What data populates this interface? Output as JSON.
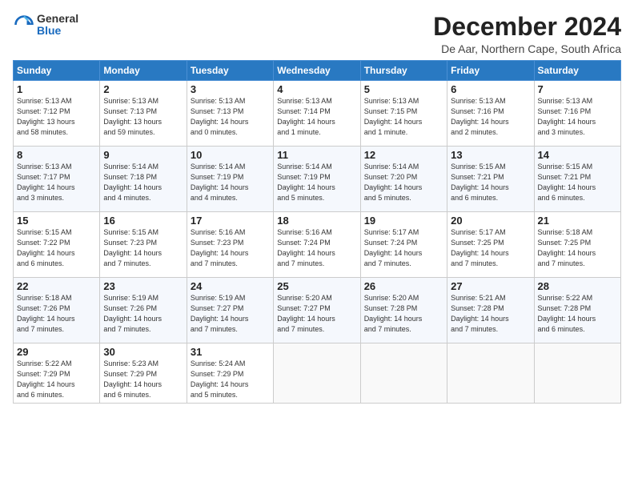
{
  "header": {
    "logo_general": "General",
    "logo_blue": "Blue",
    "month_title": "December 2024",
    "subtitle": "De Aar, Northern Cape, South Africa"
  },
  "weekdays": [
    "Sunday",
    "Monday",
    "Tuesday",
    "Wednesday",
    "Thursday",
    "Friday",
    "Saturday"
  ],
  "weeks": [
    [
      {
        "day": "1",
        "info": "Sunrise: 5:13 AM\nSunset: 7:12 PM\nDaylight: 13 hours\nand 58 minutes."
      },
      {
        "day": "2",
        "info": "Sunrise: 5:13 AM\nSunset: 7:13 PM\nDaylight: 13 hours\nand 59 minutes."
      },
      {
        "day": "3",
        "info": "Sunrise: 5:13 AM\nSunset: 7:13 PM\nDaylight: 14 hours\nand 0 minutes."
      },
      {
        "day": "4",
        "info": "Sunrise: 5:13 AM\nSunset: 7:14 PM\nDaylight: 14 hours\nand 1 minute."
      },
      {
        "day": "5",
        "info": "Sunrise: 5:13 AM\nSunset: 7:15 PM\nDaylight: 14 hours\nand 1 minute."
      },
      {
        "day": "6",
        "info": "Sunrise: 5:13 AM\nSunset: 7:16 PM\nDaylight: 14 hours\nand 2 minutes."
      },
      {
        "day": "7",
        "info": "Sunrise: 5:13 AM\nSunset: 7:16 PM\nDaylight: 14 hours\nand 3 minutes."
      }
    ],
    [
      {
        "day": "8",
        "info": "Sunrise: 5:13 AM\nSunset: 7:17 PM\nDaylight: 14 hours\nand 3 minutes."
      },
      {
        "day": "9",
        "info": "Sunrise: 5:14 AM\nSunset: 7:18 PM\nDaylight: 14 hours\nand 4 minutes."
      },
      {
        "day": "10",
        "info": "Sunrise: 5:14 AM\nSunset: 7:19 PM\nDaylight: 14 hours\nand 4 minutes."
      },
      {
        "day": "11",
        "info": "Sunrise: 5:14 AM\nSunset: 7:19 PM\nDaylight: 14 hours\nand 5 minutes."
      },
      {
        "day": "12",
        "info": "Sunrise: 5:14 AM\nSunset: 7:20 PM\nDaylight: 14 hours\nand 5 minutes."
      },
      {
        "day": "13",
        "info": "Sunrise: 5:15 AM\nSunset: 7:21 PM\nDaylight: 14 hours\nand 6 minutes."
      },
      {
        "day": "14",
        "info": "Sunrise: 5:15 AM\nSunset: 7:21 PM\nDaylight: 14 hours\nand 6 minutes."
      }
    ],
    [
      {
        "day": "15",
        "info": "Sunrise: 5:15 AM\nSunset: 7:22 PM\nDaylight: 14 hours\nand 6 minutes."
      },
      {
        "day": "16",
        "info": "Sunrise: 5:15 AM\nSunset: 7:23 PM\nDaylight: 14 hours\nand 7 minutes."
      },
      {
        "day": "17",
        "info": "Sunrise: 5:16 AM\nSunset: 7:23 PM\nDaylight: 14 hours\nand 7 minutes."
      },
      {
        "day": "18",
        "info": "Sunrise: 5:16 AM\nSunset: 7:24 PM\nDaylight: 14 hours\nand 7 minutes."
      },
      {
        "day": "19",
        "info": "Sunrise: 5:17 AM\nSunset: 7:24 PM\nDaylight: 14 hours\nand 7 minutes."
      },
      {
        "day": "20",
        "info": "Sunrise: 5:17 AM\nSunset: 7:25 PM\nDaylight: 14 hours\nand 7 minutes."
      },
      {
        "day": "21",
        "info": "Sunrise: 5:18 AM\nSunset: 7:25 PM\nDaylight: 14 hours\nand 7 minutes."
      }
    ],
    [
      {
        "day": "22",
        "info": "Sunrise: 5:18 AM\nSunset: 7:26 PM\nDaylight: 14 hours\nand 7 minutes."
      },
      {
        "day": "23",
        "info": "Sunrise: 5:19 AM\nSunset: 7:26 PM\nDaylight: 14 hours\nand 7 minutes."
      },
      {
        "day": "24",
        "info": "Sunrise: 5:19 AM\nSunset: 7:27 PM\nDaylight: 14 hours\nand 7 minutes."
      },
      {
        "day": "25",
        "info": "Sunrise: 5:20 AM\nSunset: 7:27 PM\nDaylight: 14 hours\nand 7 minutes."
      },
      {
        "day": "26",
        "info": "Sunrise: 5:20 AM\nSunset: 7:28 PM\nDaylight: 14 hours\nand 7 minutes."
      },
      {
        "day": "27",
        "info": "Sunrise: 5:21 AM\nSunset: 7:28 PM\nDaylight: 14 hours\nand 7 minutes."
      },
      {
        "day": "28",
        "info": "Sunrise: 5:22 AM\nSunset: 7:28 PM\nDaylight: 14 hours\nand 6 minutes."
      }
    ],
    [
      {
        "day": "29",
        "info": "Sunrise: 5:22 AM\nSunset: 7:29 PM\nDaylight: 14 hours\nand 6 minutes."
      },
      {
        "day": "30",
        "info": "Sunrise: 5:23 AM\nSunset: 7:29 PM\nDaylight: 14 hours\nand 6 minutes."
      },
      {
        "day": "31",
        "info": "Sunrise: 5:24 AM\nSunset: 7:29 PM\nDaylight: 14 hours\nand 5 minutes."
      },
      {
        "day": "",
        "info": ""
      },
      {
        "day": "",
        "info": ""
      },
      {
        "day": "",
        "info": ""
      },
      {
        "day": "",
        "info": ""
      }
    ]
  ]
}
